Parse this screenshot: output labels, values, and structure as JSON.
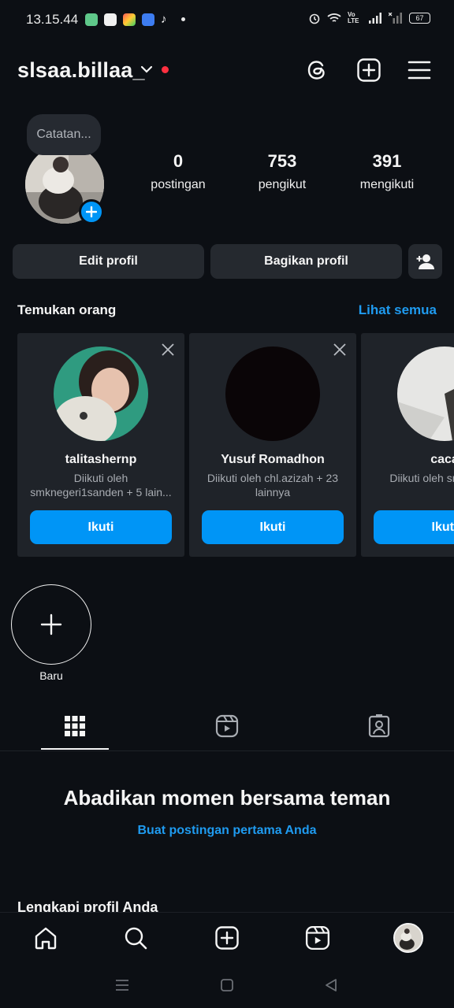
{
  "status_bar": {
    "time": "13.15.44",
    "battery": "67",
    "network": "Vo LTE"
  },
  "header": {
    "username": "slsaa.billaa_"
  },
  "profile": {
    "note_placeholder": "Catatan...",
    "stats": [
      {
        "value": "0",
        "label": "postingan"
      },
      {
        "value": "753",
        "label": "pengikut"
      },
      {
        "value": "391",
        "label": "mengikuti"
      }
    ],
    "edit_label": "Edit profil",
    "share_label": "Bagikan profil"
  },
  "discover": {
    "title": "Temukan orang",
    "see_all": "Lihat semua",
    "cards": [
      {
        "name": "talitashernp",
        "sub": "Diikuti oleh smknegeri1sanden + 5 lain...",
        "follow": "Ikuti"
      },
      {
        "name": "Yusuf Romadhon",
        "sub": "Diikuti oleh chl.azizah + 23 lainnya",
        "follow": "Ikuti"
      },
      {
        "name": "caca",
        "sub": "Diikuti oleh smu lainny",
        "follow": "Ikuti"
      }
    ]
  },
  "highlights": {
    "new_label": "Baru"
  },
  "empty_state": {
    "title": "Abadikan momen bersama teman",
    "link": "Buat postingan pertama Anda"
  },
  "complete_profile": {
    "title": "Lengkapi profil Anda"
  },
  "colors": {
    "background": "#0c0f14",
    "accent": "#0095f6",
    "link": "#1f9bf0",
    "notification": "#ff3040",
    "button": "#25292f"
  },
  "icons": {
    "header": [
      "threads-icon",
      "create-icon",
      "menu-icon"
    ],
    "tabs": [
      "grid-icon",
      "reels-icon",
      "tagged-icon"
    ],
    "bottom_nav": [
      "home-icon",
      "search-icon",
      "create-icon",
      "reels-icon",
      "profile-avatar"
    ]
  }
}
